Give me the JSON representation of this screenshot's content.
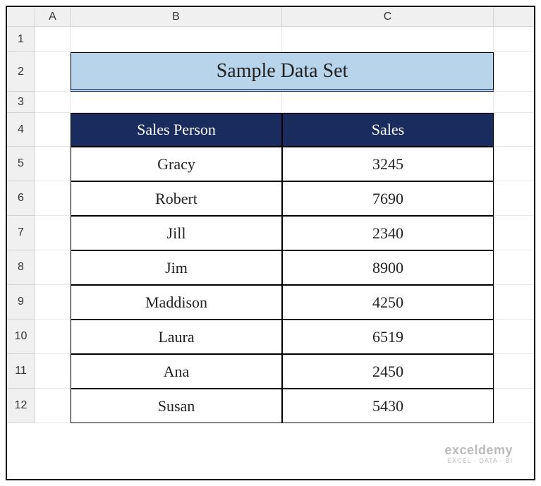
{
  "columns": [
    "",
    "A",
    "B",
    "C",
    ""
  ],
  "rows": [
    "1",
    "2",
    "3",
    "4",
    "5",
    "6",
    "7",
    "8",
    "9",
    "10",
    "11",
    "12"
  ],
  "title": "Sample Data Set",
  "headers": {
    "col1": "Sales Person",
    "col2": "Sales"
  },
  "data": [
    {
      "person": "Gracy",
      "sales": "3245"
    },
    {
      "person": "Robert",
      "sales": "7690"
    },
    {
      "person": "Jill",
      "sales": "2340"
    },
    {
      "person": "Jim",
      "sales": "8900"
    },
    {
      "person": "Maddison",
      "sales": "4250"
    },
    {
      "person": "Laura",
      "sales": "6519"
    },
    {
      "person": "Ana",
      "sales": "2450"
    },
    {
      "person": "Susan",
      "sales": "5430"
    }
  ],
  "watermark": {
    "line1": "exceldemy",
    "line2": "EXCEL · DATA · BI"
  }
}
